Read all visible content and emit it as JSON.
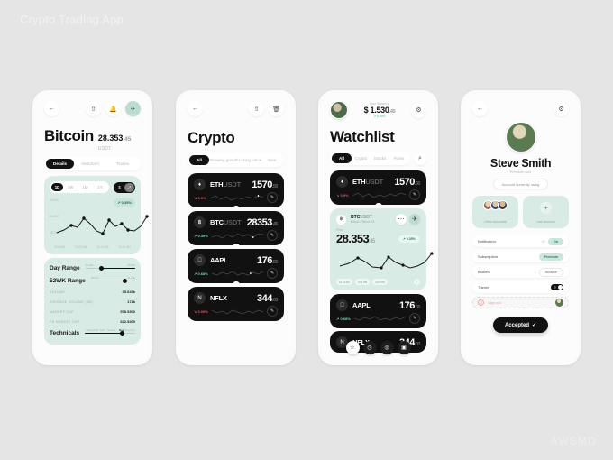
{
  "page": {
    "title": "Crypto Trading App",
    "watermark": "AWSMD",
    "background": "#e5e5e5",
    "accent": "#d9ebe5"
  },
  "phone1": {
    "header": {
      "back_icon": "arrow-left-icon",
      "share_icon": "share-icon",
      "bell_icon": "bell-icon",
      "pin_icon": "pin-icon"
    },
    "title": "Bitcoin",
    "price": "28.353",
    "price_decimals": ".45",
    "currency": "USDT",
    "tabs": [
      {
        "label": "Details",
        "active": true
      },
      {
        "label": "Important",
        "active": false
      },
      {
        "label": "Trades",
        "active": false
      }
    ],
    "ranges": [
      {
        "label": "1D",
        "active": true
      },
      {
        "label": "1W",
        "active": false
      },
      {
        "label": "1M",
        "active": false
      },
      {
        "label": "1Y",
        "active": false
      }
    ],
    "view_toggle": [
      {
        "label": "$",
        "active": false
      },
      {
        "label": "chart-icon",
        "active": true
      }
    ],
    "change_badge": "0.35%",
    "y_labels": [
      "28.400",
      "28.300",
      "28.200"
    ],
    "x_labels": [
      "9:00 AM",
      "10:00 AM",
      "11:00 AM",
      "12:00 AM"
    ],
    "stats": [
      {
        "key": "Day Range",
        "type": "slider",
        "low": "28.100",
        "high": "28.610",
        "pos": 42
      },
      {
        "key": "52WK Range",
        "type": "slider",
        "low": "16.470",
        "high": "31.800",
        "pos": 79
      },
      {
        "key": "VOLUME",
        "type": "value",
        "value": "35.643k"
      },
      {
        "key": "AVERAGE VOLUME (3M)",
        "type": "value",
        "value": "172k"
      },
      {
        "key": "MARKET CAP",
        "type": "value",
        "value": "578.5300"
      },
      {
        "key": "FD MARKET CAP",
        "type": "value",
        "value": "622.5400"
      },
      {
        "key": "Technicals",
        "type": "technicals",
        "scale": [
          "Strong Sell",
          "Sell",
          "Neutral",
          "Buy",
          "Strong Buy"
        ],
        "marker": "Buy",
        "pos": 72
      }
    ]
  },
  "phone2": {
    "header": {
      "back_icon": "arrow-left-icon",
      "share_icon": "share-icon",
      "delete_icon": "trash-icon"
    },
    "title": "Crypto",
    "tabs": [
      {
        "label": "All",
        "active": true
      },
      {
        "label": "Showing growth",
        "active": false
      },
      {
        "label": "Losing value",
        "active": false
      },
      {
        "label": "New",
        "active": false
      }
    ],
    "cards": [
      {
        "badge": "♦",
        "sym": "ETH",
        "quote": "USDT",
        "price": "1570",
        "dec": ".50",
        "change": "0.9%",
        "dir": "down"
      },
      {
        "badge": "฿",
        "sym": "BTC",
        "quote": "USDT",
        "price": "28353",
        "dec": ".45",
        "change": "0.35%",
        "dir": "up"
      },
      {
        "badge": "",
        "sym": "AAPL",
        "quote": "",
        "price": "176",
        "dec": ".55",
        "change": "0.68%",
        "dir": "up"
      },
      {
        "badge": "N",
        "sym": "NFLX",
        "quote": "",
        "price": "344",
        "dec": ".03",
        "change": "0.09%",
        "dir": "down"
      }
    ]
  },
  "phone3": {
    "header": {
      "avatar": "user-avatar",
      "balance_label": "Your Balance",
      "balance": "$ 1.530",
      "balance_dec": ".45",
      "balance_change": "0.35%",
      "gear_icon": "gear-icon"
    },
    "title": "Watchlist",
    "tabs": [
      {
        "label": "All",
        "active": true
      },
      {
        "label": "Crypto",
        "active": false
      },
      {
        "label": "Stocks",
        "active": false
      },
      {
        "label": "Forex",
        "active": false
      }
    ],
    "search_icon": "search-icon",
    "eth": {
      "badge": "♦",
      "sym": "ETH",
      "quote": "USDT",
      "price": "1570",
      "dec": ".50",
      "change": "0.9%",
      "dir": "down"
    },
    "featured": {
      "badge": "฿",
      "sym": "BTC",
      "quote": "USDT",
      "sub": "Bitcoin / Tether US",
      "label": "Price",
      "price": "28.353",
      "dec": ".45",
      "change": "0.35%",
      "more_icon": "more-icon",
      "pin_icon": "pin-icon",
      "x_labels": [
        "10:24 AM",
        "2:07 PM",
        "2:07 PM"
      ]
    },
    "aapl": {
      "badge": "",
      "sym": "AAPL",
      "quote": "",
      "price": "176",
      "dec": ".55",
      "change": "0.68%",
      "dir": "up"
    },
    "nflx": {
      "badge": "N",
      "sym": "NFLX",
      "quote": "",
      "price": "344",
      "dec": ".03",
      "change": "0.09%",
      "dir": "down"
    },
    "nav": [
      {
        "icon": "star-icon",
        "glyph": "☆",
        "active": true
      },
      {
        "icon": "clock-icon",
        "glyph": "◷",
        "active": false
      },
      {
        "icon": "compass-icon",
        "glyph": "◎",
        "active": false
      },
      {
        "icon": "wallet-icon",
        "glyph": "▣",
        "active": false
      }
    ]
  },
  "phone4": {
    "header": {
      "back_icon": "arrow-left-icon",
      "gear_icon": "gear-icon"
    },
    "name": "Steve Smith",
    "role": "Premium user",
    "chip": "Account currently using",
    "accounts": {
      "other_label": "Other Accounts",
      "link_label": "Link Account",
      "plus": "+"
    },
    "settings": [
      {
        "key": "Notification",
        "off": "Off",
        "value": "On",
        "style": "mint"
      },
      {
        "key": "Subscription",
        "off": "",
        "value": "Premium",
        "style": "mint"
      },
      {
        "key": "Brokers",
        "off": "",
        "value": "Binance",
        "style": "white"
      },
      {
        "key": "Theme",
        "off": "",
        "value": "",
        "style": "toggle"
      }
    ],
    "signout": "Sign out",
    "signout_icon": "power-icon",
    "accept_button": "Accepted",
    "accept_check": "✓"
  }
}
